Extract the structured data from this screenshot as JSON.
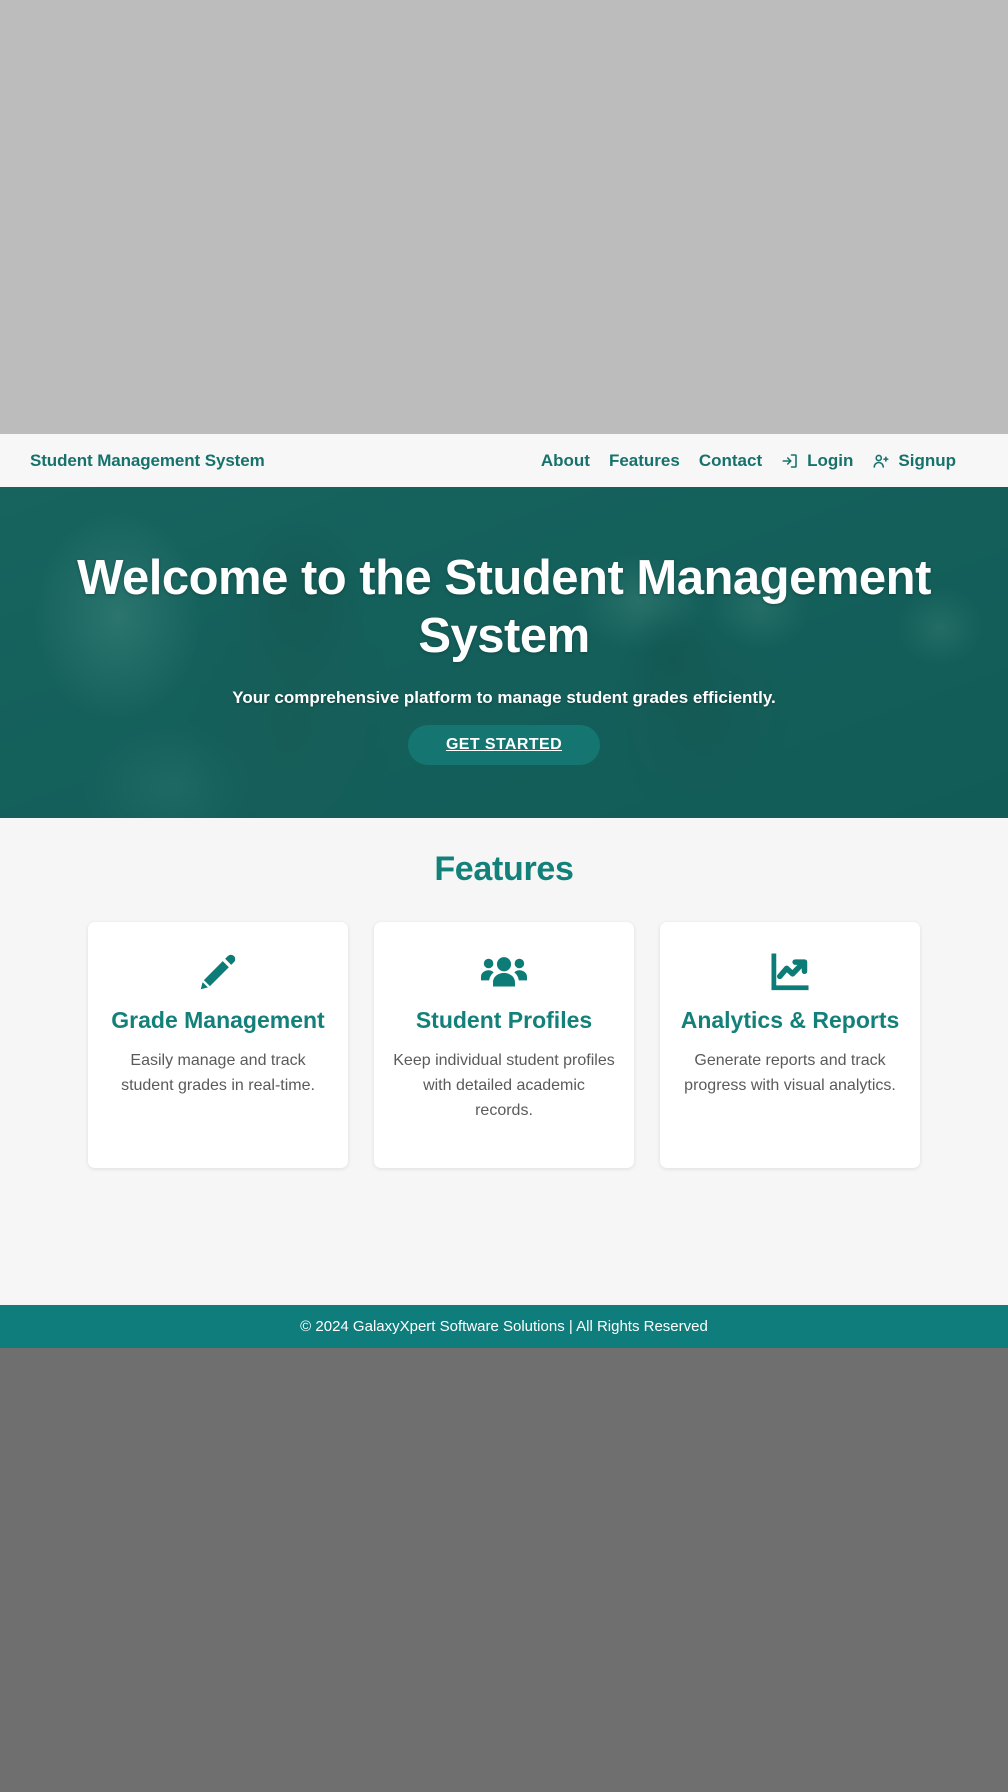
{
  "navbar": {
    "brand": "Student Management System",
    "links": [
      {
        "label": "About",
        "icon": null
      },
      {
        "label": "Features",
        "icon": null
      },
      {
        "label": "Contact",
        "icon": null
      },
      {
        "label": "Login",
        "icon": "sign-in-icon"
      },
      {
        "label": "Signup",
        "icon": "user-plus-icon"
      }
    ]
  },
  "hero": {
    "title_line1": "Welcome to the Student Management",
    "title_line2": "System",
    "subtitle": "Your comprehensive platform to manage student grades efficiently.",
    "cta_label": "GET STARTED"
  },
  "features": {
    "heading": "Features",
    "cards": [
      {
        "icon": "pencil-icon",
        "title": "Grade Management",
        "text": "Easily manage and track student grades in real-time."
      },
      {
        "icon": "users-group-icon",
        "title": "Student Profiles",
        "text": "Keep individual student profiles with detailed academic records."
      },
      {
        "icon": "chart-line-up-icon",
        "title": "Analytics & Reports",
        "text": "Generate reports and track progress with visual analytics."
      }
    ]
  },
  "footer": {
    "text": "© 2024 GalaxyXpert Software Solutions | All Rights Reserved"
  },
  "colors": {
    "brand_teal": "#17726c",
    "accent_teal": "#14807a",
    "footer_teal": "#0e7d7c",
    "hero_overlay": "#136a65",
    "page_bg": "#f6f6f6",
    "navbar_bg": "#f7f7f7",
    "shell_top_gray": "#bcbcbc",
    "shell_bottom_gray": "#6f6f6f"
  }
}
